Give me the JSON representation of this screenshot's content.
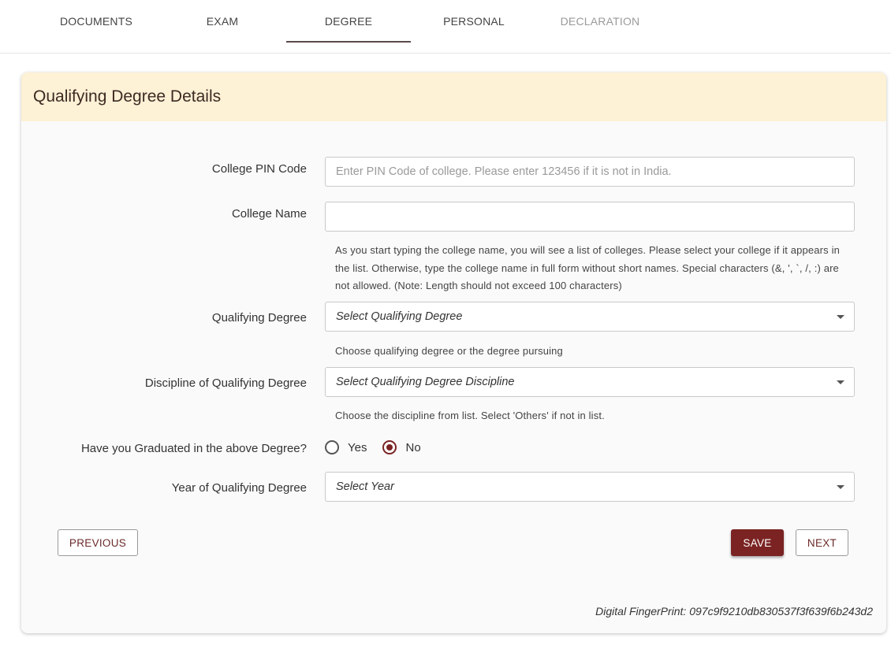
{
  "tabs": [
    {
      "label": "DOCUMENTS",
      "state": "normal"
    },
    {
      "label": "EXAM",
      "state": "normal"
    },
    {
      "label": "DEGREE",
      "state": "active"
    },
    {
      "label": "PERSONAL",
      "state": "normal"
    },
    {
      "label": "DECLARATION",
      "state": "disabled"
    }
  ],
  "card": {
    "title": "Qualifying Degree Details"
  },
  "form": {
    "pin": {
      "label": "College PIN Code",
      "value": "",
      "placeholder": "Enter PIN Code of college. Please enter 123456 if it is not in India."
    },
    "college_name": {
      "label": "College Name",
      "value": "",
      "help": "As you start typing the college name, you will see a list of colleges. Please select your college if it appears in the list. Otherwise, type the college name in full form without short names. Special characters (&, ', `, /, :) are not allowed. (Note: Length should not exceed 100 characters)"
    },
    "degree": {
      "label": "Qualifying Degree",
      "value": "Select Qualifying Degree",
      "help": "Choose qualifying degree or the degree pursuing"
    },
    "discipline": {
      "label": "Discipline of Qualifying Degree",
      "value": "Select Qualifying Degree Discipline",
      "help": "Choose the discipline from list. Select 'Others' if not in list."
    },
    "graduated": {
      "label": "Have you Graduated in the above Degree?",
      "options": [
        "Yes",
        "No"
      ],
      "selected": "No"
    },
    "year": {
      "label": "Year of Qualifying Degree",
      "value": "Select Year"
    }
  },
  "buttons": {
    "previous": "PREVIOUS",
    "save": "SAVE",
    "next": "NEXT"
  },
  "footer": {
    "fingerprint": "Digital FingerPrint: 097c9f9210db830537f3f639f6b243d2"
  },
  "colors": {
    "accent": "#7b2323",
    "header_bg": "#fdf1d6"
  }
}
